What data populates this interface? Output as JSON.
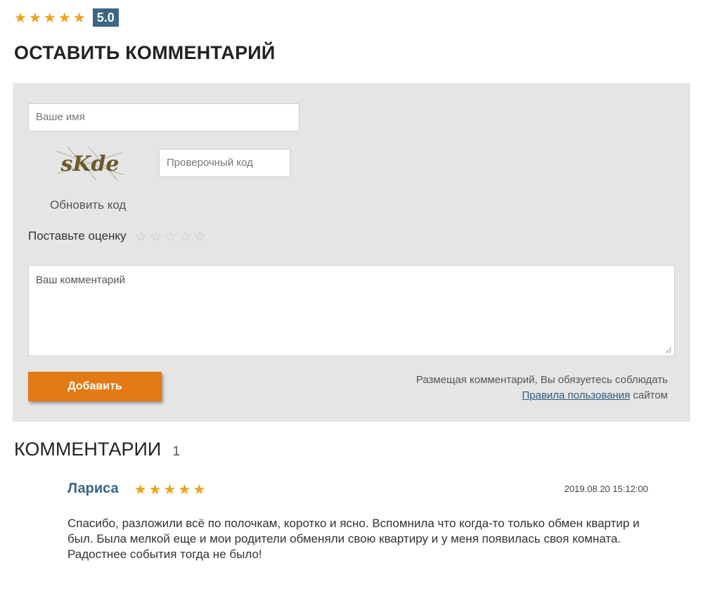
{
  "rating": {
    "stars": 5,
    "score": "5.0",
    "star_color": "#f0a11a",
    "badge_color": "#3b6584"
  },
  "leave_comment_heading": "ОСТАВИТЬ КОММЕНТАРИЙ",
  "form": {
    "name_placeholder": "Ваше имя",
    "captcha_text": "sKde",
    "code_placeholder": "Проверочный код",
    "refresh_label": "Обновить код",
    "rate_label": "Поставьте оценку",
    "rate_stars": 5,
    "comment_placeholder": "Ваш комментарий",
    "submit_label": "Добавить",
    "submit_color": "#e37a16",
    "terms_prefix": "Размещая комментарий, Вы обязуетесь соблюдать",
    "terms_link": "Правила пользования",
    "terms_suffix": "сайтом"
  },
  "comments_section": {
    "heading": "КОММЕНТАРИИ",
    "count": "1",
    "items": [
      {
        "author": "Лариса",
        "stars": 5,
        "date": "2019.08.20 15:12:00",
        "text": "Спасибо, разложили всё по полочкам, коротко и ясно. Вспомнила что когда-то только обмен квартир и был. Была мелкой еще и мои родители обменяли свою квартиру и у меня появилась своя комната. Радостнее события тогда не было!"
      }
    ]
  }
}
